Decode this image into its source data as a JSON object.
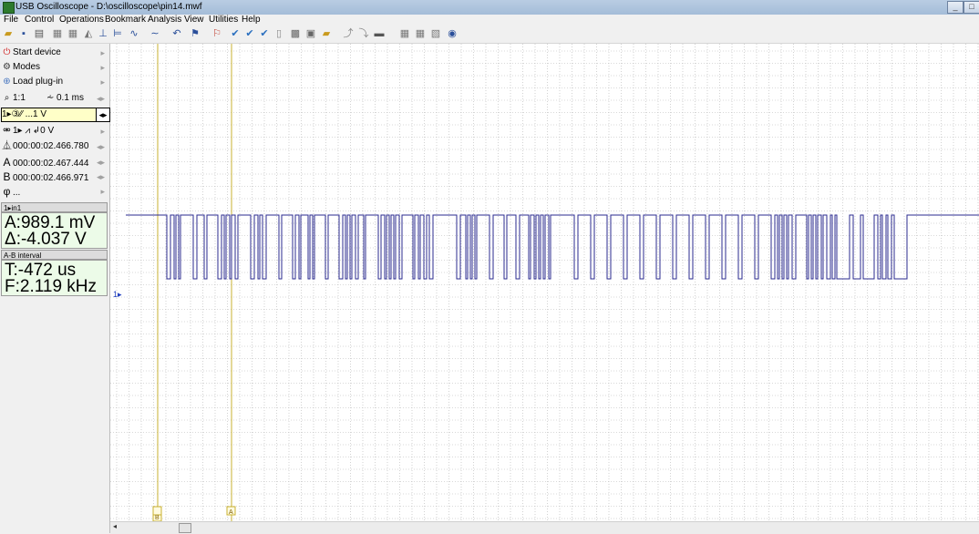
{
  "window": {
    "title": "USB Oscilloscope - D:\\oscilloscope\\pin14.mwf"
  },
  "menu": [
    "File",
    "Control",
    "Operations",
    "Bookmark",
    "Analysis",
    "View",
    "Utilities",
    "Help"
  ],
  "left_panel": {
    "start_device": "Start device",
    "modes": "Modes",
    "load_plugin": "Load plug-in",
    "zoom_ratio": "1:1",
    "time_div": "0.1 ms",
    "channel_row": "1▸③⁄⁄ ...1 V",
    "trigger_row": "1▸ ⩘ ↲0 V",
    "time_cursor": "000:00:02.466.780",
    "cursor_a": "000:00:02.467.444",
    "cursor_b": "000:00:02.466.971",
    "phi": "...",
    "measure_header": "1▸in1",
    "measure_a": "A:989.1 mV",
    "measure_delta": "Δ:-4.037 V",
    "interval_header": "A-B interval",
    "interval_t": "T:-472 us",
    "interval_f": "F:2.119 kHz"
  },
  "scope": {
    "channel_marker": "1▸",
    "cursor_a_label": "A",
    "cursor_b_label": "B",
    "trace_color": "#2b2b8f",
    "cursor_color": "#c8b030",
    "grid_color": "#b4b4b4"
  }
}
